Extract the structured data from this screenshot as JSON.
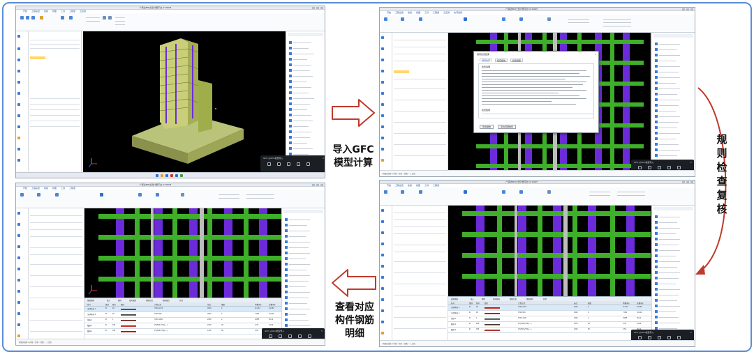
{
  "app": {
    "title_bar": "广联达BIM土建计量平台 GTJ2025",
    "menu": [
      "开始",
      "工程设置",
      "建模",
      "视图",
      "工具",
      "工程量",
      "云应用",
      "协同建模",
      "IGMS"
    ],
    "status_text": "跨图层选择 ● 折线 ○ 矩形 ○ 圆形 ○ 三点弧",
    "mini_toolbar_title": "GFC 从GFC模型导入"
  },
  "captions": {
    "import": [
      "导入GFC",
      "模型计算"
    ],
    "rule_check": [
      "规",
      "则",
      "检",
      "查",
      "复",
      "核"
    ],
    "view_rebar": [
      "查看对应",
      "构件钢筋",
      "明细"
    ]
  },
  "dialog": {
    "title": "规则检查结果",
    "tabs": [
      "规则检查",
      "核查报告",
      "检查结果"
    ],
    "section_heads": [
      "检查说明",
      "检查结果"
    ],
    "buttons": [
      "导出报告",
      "定位问题构件"
    ]
  },
  "rebar_table": {
    "toolbar": [
      "编辑钢筋",
      "插入",
      "删除",
      "缩尺配筋",
      "钢筋信息",
      "钢筋图库",
      "其他"
    ],
    "columns": [
      "筋号",
      "直径(mm)",
      "级别",
      "图号",
      "图形",
      "计算公式",
      "公式描述",
      "长度",
      "根数",
      "搭接",
      "损耗(%)",
      "单重(kg)",
      "总重(kg)"
    ],
    "rows": [
      [
        "全部纵筋.1",
        "20",
        "Ф",
        "18",
        "3700+41*d",
        "层高-本层的露出长度",
        "4520",
        "4",
        "1",
        "0",
        "11.163",
        "44.652"
      ],
      [
        "全部纵筋.2",
        "20",
        "Ф",
        "18",
        "3700-500",
        "层高-本层的露出长度",
        "3200",
        "4",
        "1",
        "0",
        "7.904",
        "31.616"
      ],
      [
        "角筋.1",
        "25",
        "Ф",
        "1",
        "3700-1400",
        "层高-本层的露出长度",
        "2300",
        "4",
        "1",
        "0",
        "8.855",
        "35.42"
      ],
      [
        "箍筋.1",
        "8",
        "Ф",
        "195",
        "2*((500-2*20)+...)",
        "",
        "1976",
        "28",
        "0",
        "0",
        "0.78",
        "21.84"
      ],
      [
        "箍筋.2",
        "8",
        "Ф",
        "195",
        "2*((500-2*20)+...)",
        "",
        "1316",
        "56",
        "0",
        "0",
        "0.52",
        "29.12"
      ]
    ]
  },
  "colors": {
    "frame": "#5b8dd6",
    "arrow": "#c0392b",
    "beam_green": "#3fae2a",
    "column_purple": "#6c2bd9"
  }
}
